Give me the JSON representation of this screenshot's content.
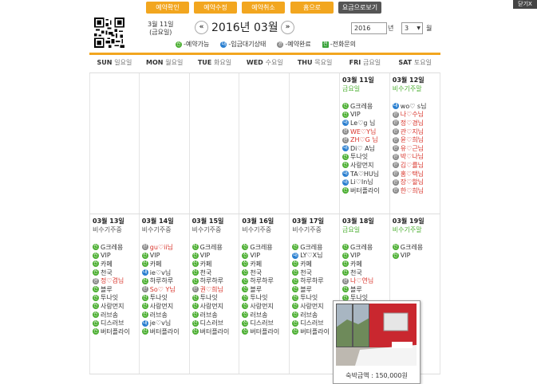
{
  "toolbar": {
    "buttons": [
      "예약확인",
      "예약수정",
      "예약취소",
      "홈으로"
    ],
    "rates_label": "요금으로보기",
    "close_label": "닫기X"
  },
  "header": {
    "today_date": "3월 11일",
    "today_weekday": "(금요일)",
    "prev_label": "«",
    "next_label": "»",
    "month_title": "2016년 03월",
    "year_value": "2016",
    "year_suffix": "년",
    "month_value": "3",
    "month_suffix": "월"
  },
  "legend": [
    {
      "icon": "green",
      "glyph": "신",
      "label": "-예약가능"
    },
    {
      "icon": "blue",
      "glyph": "대",
      "label": "-입금대기상태"
    },
    {
      "icon": "gray",
      "glyph": "완",
      "label": "-예약완료"
    },
    {
      "icon": "phone",
      "glyph": "전",
      "label": "-전화문의"
    }
  ],
  "weekdays": [
    {
      "en": "SUN",
      "ko": "일요일"
    },
    {
      "en": "MON",
      "ko": "월요일"
    },
    {
      "en": "TUE",
      "ko": "화요일"
    },
    {
      "en": "WED",
      "ko": "수요일"
    },
    {
      "en": "THU",
      "ko": "목요일"
    },
    {
      "en": "FRI",
      "ko": "금요일"
    },
    {
      "en": "SAT",
      "ko": "토요일"
    }
  ],
  "weeks": [
    [
      null,
      null,
      null,
      null,
      null,
      {
        "date": "03월 11일",
        "sub": "금요일",
        "sub_type": "today",
        "rooms": [
          {
            "s": "available",
            "glyph": "신",
            "name": "G크레용"
          },
          {
            "s": "available",
            "glyph": "신",
            "name": "VIP"
          },
          {
            "s": "pending",
            "glyph": "대",
            "name": "Le♡g 님"
          },
          {
            "s": "complete",
            "glyph": "완",
            "name": "WE♡Y님"
          },
          {
            "s": "complete",
            "glyph": "완",
            "name": "ZH♡G 님"
          },
          {
            "s": "pending",
            "glyph": "대",
            "name": "Di♡ A님"
          },
          {
            "s": "available",
            "glyph": "신",
            "name": "투나잇"
          },
          {
            "s": "available",
            "glyph": "신",
            "name": "사랑먼지"
          },
          {
            "s": "pending",
            "glyph": "대",
            "name": "TA♡HU님"
          },
          {
            "s": "pending",
            "glyph": "대",
            "name": "Li♡In님"
          },
          {
            "s": "available",
            "glyph": "신",
            "name": "버터플라이"
          }
        ]
      },
      {
        "date": "03월 12일",
        "sub": "비수기주말",
        "sub_type": "peak",
        "rooms": [
          {
            "s": "pending",
            "glyph": "대",
            "name": "wo♡ s님"
          },
          {
            "s": "complete",
            "glyph": "완",
            "name": "나♡수님"
          },
          {
            "s": "complete",
            "glyph": "완",
            "name": "정♡경님"
          },
          {
            "s": "complete",
            "glyph": "완",
            "name": "관♡지님"
          },
          {
            "s": "complete",
            "glyph": "완",
            "name": "윤♡희님"
          },
          {
            "s": "complete",
            "glyph": "완",
            "name": "유♡근님"
          },
          {
            "s": "complete",
            "glyph": "완",
            "name": "박♡나님"
          },
          {
            "s": "complete",
            "glyph": "완",
            "name": "김♡률님"
          },
          {
            "s": "complete",
            "glyph": "완",
            "name": "홍♡택님"
          },
          {
            "s": "complete",
            "glyph": "완",
            "name": "장♡할님"
          },
          {
            "s": "complete",
            "glyph": "완",
            "name": "한♡희님"
          }
        ]
      }
    ],
    [
      {
        "date": "03월 13일",
        "sub": "비수기주중",
        "sub_type": "normal",
        "rooms": [
          {
            "s": "available",
            "glyph": "신",
            "name": "G크레용"
          },
          {
            "s": "available",
            "glyph": "신",
            "name": "VIP"
          },
          {
            "s": "available",
            "glyph": "신",
            "name": "카페"
          },
          {
            "s": "available",
            "glyph": "신",
            "name": "천국"
          },
          {
            "s": "complete",
            "glyph": "완",
            "name": "정♡겸님"
          },
          {
            "s": "available",
            "glyph": "신",
            "name": "블루"
          },
          {
            "s": "available",
            "glyph": "신",
            "name": "투나잇"
          },
          {
            "s": "available",
            "glyph": "신",
            "name": "사랑먼지"
          },
          {
            "s": "available",
            "glyph": "신",
            "name": "러브송"
          },
          {
            "s": "available",
            "glyph": "신",
            "name": "디스러브"
          },
          {
            "s": "available",
            "glyph": "신",
            "name": "버터플라이"
          }
        ]
      },
      {
        "date": "03월 14일",
        "sub": "비수기주중",
        "sub_type": "normal",
        "rooms": [
          {
            "s": "complete",
            "glyph": "완",
            "name": "gu♡ii님"
          },
          {
            "s": "available",
            "glyph": "신",
            "name": "VIP"
          },
          {
            "s": "available",
            "glyph": "신",
            "name": "카페"
          },
          {
            "s": "pending",
            "glyph": "대",
            "name": "ie♡v님"
          },
          {
            "s": "available",
            "glyph": "신",
            "name": "하루하루"
          },
          {
            "s": "complete",
            "glyph": "완",
            "name": "So♡ Y님"
          },
          {
            "s": "available",
            "glyph": "신",
            "name": "투나잇"
          },
          {
            "s": "available",
            "glyph": "신",
            "name": "사랑먼지"
          },
          {
            "s": "available",
            "glyph": "신",
            "name": "러브송"
          },
          {
            "s": "pending",
            "glyph": "대",
            "name": "je♡v님"
          },
          {
            "s": "available",
            "glyph": "신",
            "name": "버터플라이"
          }
        ]
      },
      {
        "date": "03월 15일",
        "sub": "비수기주중",
        "sub_type": "normal",
        "rooms": [
          {
            "s": "available",
            "glyph": "신",
            "name": "G크레용"
          },
          {
            "s": "available",
            "glyph": "신",
            "name": "VIP"
          },
          {
            "s": "available",
            "glyph": "신",
            "name": "카페"
          },
          {
            "s": "available",
            "glyph": "신",
            "name": "천국"
          },
          {
            "s": "available",
            "glyph": "신",
            "name": "하루하루"
          },
          {
            "s": "complete",
            "glyph": "완",
            "name": "권♡희님"
          },
          {
            "s": "available",
            "glyph": "신",
            "name": "투나잇"
          },
          {
            "s": "available",
            "glyph": "신",
            "name": "사랑먼지"
          },
          {
            "s": "available",
            "glyph": "신",
            "name": "러브송"
          },
          {
            "s": "available",
            "glyph": "신",
            "name": "디스러브"
          },
          {
            "s": "available",
            "glyph": "신",
            "name": "버터플라이"
          }
        ]
      },
      {
        "date": "03월 16일",
        "sub": "비수기주중",
        "sub_type": "normal",
        "rooms": [
          {
            "s": "available",
            "glyph": "신",
            "name": "G크레용"
          },
          {
            "s": "available",
            "glyph": "신",
            "name": "VIP"
          },
          {
            "s": "available",
            "glyph": "신",
            "name": "카페"
          },
          {
            "s": "available",
            "glyph": "신",
            "name": "천국"
          },
          {
            "s": "available",
            "glyph": "신",
            "name": "하루하루"
          },
          {
            "s": "available",
            "glyph": "신",
            "name": "블루"
          },
          {
            "s": "available",
            "glyph": "신",
            "name": "투나잇"
          },
          {
            "s": "available",
            "glyph": "신",
            "name": "사랑먼지"
          },
          {
            "s": "available",
            "glyph": "신",
            "name": "러브송"
          },
          {
            "s": "available",
            "glyph": "신",
            "name": "디스러브"
          },
          {
            "s": "available",
            "glyph": "신",
            "name": "버터플라이"
          }
        ]
      },
      {
        "date": "03월 17일",
        "sub": "비수기주중",
        "sub_type": "normal",
        "rooms": [
          {
            "s": "available",
            "glyph": "신",
            "name": "G크레용"
          },
          {
            "s": "pending",
            "glyph": "대",
            "name": "LY♡X님"
          },
          {
            "s": "available",
            "glyph": "신",
            "name": "카페"
          },
          {
            "s": "available",
            "glyph": "신",
            "name": "천국"
          },
          {
            "s": "available",
            "glyph": "신",
            "name": "하루하루"
          },
          {
            "s": "available",
            "glyph": "신",
            "name": "블루"
          },
          {
            "s": "available",
            "glyph": "신",
            "name": "투나잇"
          },
          {
            "s": "available",
            "glyph": "신",
            "name": "사랑먼지"
          },
          {
            "s": "available",
            "glyph": "신",
            "name": "러브송"
          },
          {
            "s": "available",
            "glyph": "신",
            "name": "디스러브"
          },
          {
            "s": "available",
            "glyph": "신",
            "name": "버터플라이"
          }
        ]
      },
      {
        "date": "03월 18일",
        "sub": "금요일",
        "sub_type": "today",
        "rooms": [
          {
            "s": "available",
            "glyph": "신",
            "name": "G크레용"
          },
          {
            "s": "available",
            "glyph": "신",
            "name": "VIP"
          },
          {
            "s": "available",
            "glyph": "신",
            "name": "카페"
          },
          {
            "s": "available",
            "glyph": "신",
            "name": "천국"
          },
          {
            "s": "complete",
            "glyph": "완",
            "name": "나♡연님"
          },
          {
            "s": "available",
            "glyph": "신",
            "name": "블루"
          },
          {
            "s": "available",
            "glyph": "신",
            "name": "투나잇"
          }
        ]
      },
      {
        "date": "03월 19일",
        "sub": "비수기주말",
        "sub_type": "peak",
        "rooms": [
          {
            "s": "available",
            "glyph": "신",
            "name": "G크레용"
          },
          {
            "s": "available",
            "glyph": "신",
            "name": "VIP"
          }
        ]
      }
    ]
  ],
  "popup": {
    "price_label": "숙박금액 : 150,000원"
  },
  "colors": {
    "accent": "#f2a61f",
    "available": "#4caf32",
    "pending": "#2a7fd0",
    "complete": "#888888",
    "booked_text": "#d9342b"
  }
}
